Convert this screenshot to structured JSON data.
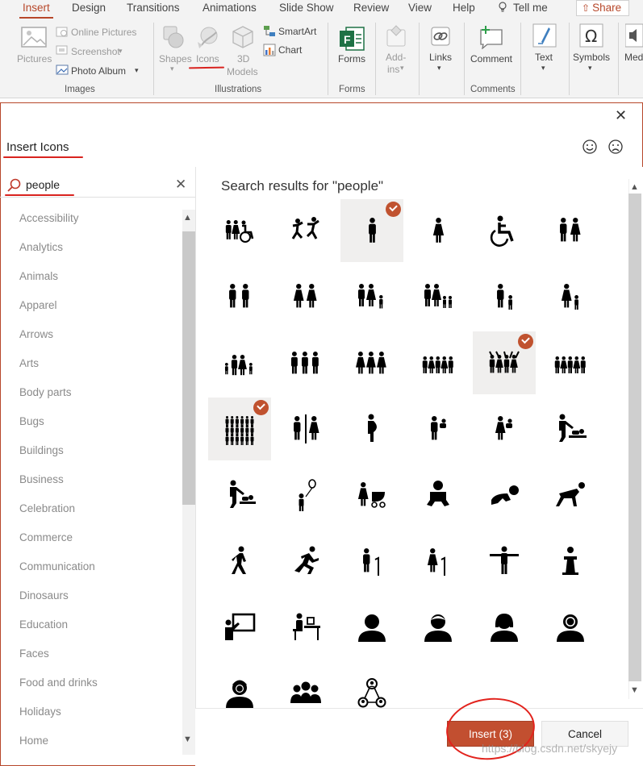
{
  "ribbon": {
    "tabs": [
      {
        "label": "Insert",
        "active": true
      },
      {
        "label": "Design"
      },
      {
        "label": "Transitions"
      },
      {
        "label": "Animations"
      },
      {
        "label": "Slide Show"
      },
      {
        "label": "Review"
      },
      {
        "label": "View"
      },
      {
        "label": "Help"
      }
    ],
    "tell_me": "Tell me",
    "share": "Share",
    "images": {
      "pictures": "Pictures",
      "online_pictures": "Online Pictures",
      "screenshot": "Screenshot",
      "photo_album": "Photo Album",
      "group": "Images"
    },
    "illustrations": {
      "shapes": "Shapes",
      "icons": "Icons",
      "models_3d_line1": "3D",
      "models_3d_line2": "Models",
      "smartart": "SmartArt",
      "chart": "Chart",
      "group": "Illustrations"
    },
    "forms": {
      "label": "Forms",
      "group": "Forms"
    },
    "addins": {
      "line1": "Add-",
      "line2": "ins"
    },
    "links": {
      "label": "Links"
    },
    "comments": {
      "label": "Comment",
      "group": "Comments"
    },
    "text": {
      "label": "Text"
    },
    "symbols": {
      "label": "Symbols"
    },
    "media": {
      "label": "Med"
    }
  },
  "dialog": {
    "title": "Insert Icons",
    "close_glyph": "✕",
    "search": {
      "value": "people",
      "clear_glyph": "✕"
    },
    "results_title": "Search results for \"people\"",
    "categories": [
      "Accessibility",
      "Analytics",
      "Animals",
      "Apparel",
      "Arrows",
      "Arts",
      "Body parts",
      "Bugs",
      "Buildings",
      "Business",
      "Celebration",
      "Commerce",
      "Communication",
      "Dinosaurs",
      "Education",
      "Faces",
      "Food and drinks",
      "Holidays",
      "Home"
    ],
    "icons": [
      {
        "name": "family-wheelchair-icon",
        "selected": false
      },
      {
        "name": "people-dancing-icon",
        "selected": false
      },
      {
        "name": "man-icon",
        "selected": true
      },
      {
        "name": "woman-icon",
        "selected": false
      },
      {
        "name": "wheelchair-icon",
        "selected": false
      },
      {
        "name": "man-woman-icon",
        "selected": false
      },
      {
        "name": "two-men-icon",
        "selected": false
      },
      {
        "name": "two-women-icon",
        "selected": false
      },
      {
        "name": "family-child-icon",
        "selected": false
      },
      {
        "name": "family-two-children-icon",
        "selected": false
      },
      {
        "name": "man-child-icon",
        "selected": false
      },
      {
        "name": "woman-child-icon",
        "selected": false
      },
      {
        "name": "family-group-icon",
        "selected": false
      },
      {
        "name": "three-men-icon",
        "selected": false
      },
      {
        "name": "three-women-icon",
        "selected": false
      },
      {
        "name": "crowd-small-icon",
        "selected": false
      },
      {
        "name": "cheering-crowd-icon",
        "selected": true
      },
      {
        "name": "crowd-mixed-icon",
        "selected": false
      },
      {
        "name": "large-crowd-icon",
        "selected": true
      },
      {
        "name": "restroom-icon",
        "selected": false
      },
      {
        "name": "pregnant-woman-icon",
        "selected": false
      },
      {
        "name": "man-holding-baby-icon",
        "selected": false
      },
      {
        "name": "woman-holding-baby-icon",
        "selected": false
      },
      {
        "name": "baby-changing-icon",
        "selected": false
      },
      {
        "name": "man-changing-baby-icon",
        "selected": false
      },
      {
        "name": "child-balloon-icon",
        "selected": false
      },
      {
        "name": "woman-stroller-icon",
        "selected": false
      },
      {
        "name": "baby-icon",
        "selected": false
      },
      {
        "name": "baby-crawling-icon",
        "selected": false
      },
      {
        "name": "person-crawling-icon",
        "selected": false
      },
      {
        "name": "person-walking-icon",
        "selected": false
      },
      {
        "name": "person-running-icon",
        "selected": false
      },
      {
        "name": "elderly-man-icon",
        "selected": false
      },
      {
        "name": "elderly-woman-icon",
        "selected": false
      },
      {
        "name": "person-arms-out-icon",
        "selected": false
      },
      {
        "name": "speaker-podium-icon",
        "selected": false
      },
      {
        "name": "presenter-board-icon",
        "selected": false
      },
      {
        "name": "person-at-desk-icon",
        "selected": false
      },
      {
        "name": "user-silhouette-icon",
        "selected": false
      },
      {
        "name": "user-man-icon",
        "selected": false
      },
      {
        "name": "user-woman-icon",
        "selected": false
      },
      {
        "name": "user-girl-icon",
        "selected": false
      },
      {
        "name": "user-boy-icon",
        "selected": false
      },
      {
        "name": "user-group-icon",
        "selected": false
      },
      {
        "name": "user-network-icon",
        "selected": false
      }
    ],
    "insert_label": "Insert (3)",
    "cancel_label": "Cancel"
  },
  "watermark": "https://blog.csdn.net/skyejy",
  "colors": {
    "accent": "#b7472a",
    "selected_tile": "#f0efee",
    "check": "#c0522f",
    "annotation": "#e2231d"
  }
}
